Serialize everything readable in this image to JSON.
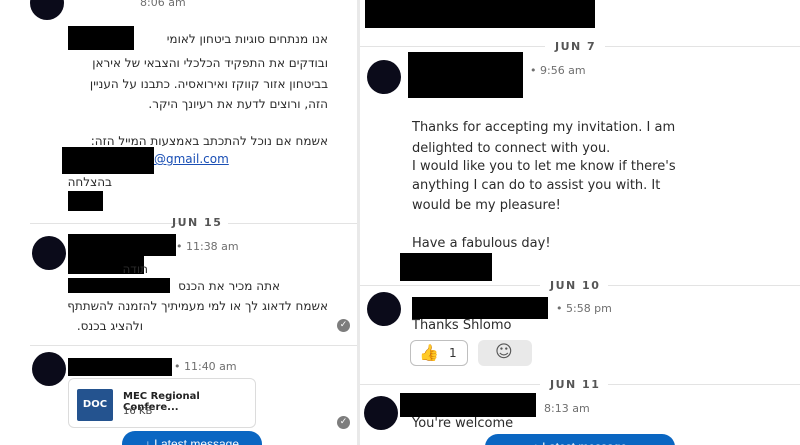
{
  "left": {
    "top_time": "8:06 am",
    "hebrew_lines": [
      "אנו מנתחים סוגיות ביטחון לאומי",
      "ובודקים את התפקיד הכלכלי והצבאי של איראן",
      "בביטחון אזור קווקז ואירואסיה. כתבנו על העניין",
      "הזה, ורוצים לדעת את רעיונך היקר."
    ],
    "hebrew_request": "אשמח אם נוכל להתכתב באמצעות המייל הזה:",
    "email_suffix": "@gmail.com",
    "closing": "בהצלחה",
    "date_jun15": "JUN 15",
    "msg2_time": "• 11:38 am",
    "msg2_thanks": "תודה",
    "msg2_lines": [
      "אתה מכיר את הכנס",
      "אשמח לדאוג לך או למי מעמיתיך להזמנה להשתתף",
      "ולהציג בכנס."
    ],
    "msg3_time": "• 11:40 am",
    "attachment": {
      "icon_label": "DOC",
      "name": "MEC Regional Confere...",
      "size": "16 KB"
    },
    "latest_button": "↓ Latest message"
  },
  "right": {
    "date_jun7": "JUN 7",
    "msg1_time": "• 9:56 am",
    "msg1_lines": [
      "Thanks for accepting my invitation. I am",
      "delighted to connect with you.",
      "I would like you to let me know if there's",
      "anything I can do to assist you with. It",
      "would be my pleasure!",
      "",
      "Have a fabulous day!"
    ],
    "date_jun10": "JUN 10",
    "msg2_time": "• 5:58 pm",
    "msg2_text": "Thanks Shlomo",
    "reaction_emoji": "👍",
    "reaction_count": "1",
    "add_reaction_icon": "☺",
    "date_jun11": "JUN 11",
    "msg3_time": "8:13 am",
    "msg3_text": "You're welcome",
    "latest_button": "↓ Latest message"
  },
  "colors": {
    "accent": "#0a66c2",
    "doc_icon": "#24538f",
    "redaction": "#000000",
    "avatar": "#0b0b1a"
  }
}
